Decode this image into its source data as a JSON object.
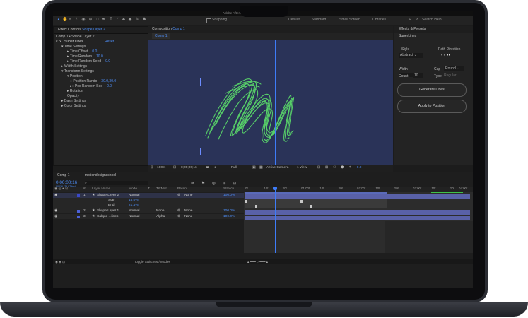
{
  "menubar": {
    "title": "Adobe After Effects 2024 - Untitled Project *"
  },
  "toolbar": {
    "snapping_label": "Snapping",
    "workspaces": [
      "Default",
      "Standard",
      "Small Screen",
      "Libraries"
    ],
    "search_placeholder": "Search Help"
  },
  "effect_controls": {
    "tab_prefix": "Effect Controls",
    "tab_layer": "Shape Layer 2",
    "breadcrumb": "Comp 1 • Shape Layer 2",
    "effect_name": "Super Lines",
    "reset_label": "Reset",
    "properties": [
      {
        "label": "Time Settings",
        "value": ""
      },
      {
        "label": "Time Offset",
        "value": "0.0"
      },
      {
        "label": "Time Random",
        "value": "10.0"
      },
      {
        "label": "Time Random Seed",
        "value": "0.0"
      },
      {
        "label": "Width Settings",
        "value": ""
      },
      {
        "label": "Transform Settings",
        "value": ""
      },
      {
        "label": "Position",
        "value": ""
      },
      {
        "label": "Position Rando",
        "value": "30.0,30.0"
      },
      {
        "label": "Pos Random See",
        "value": "0.0"
      },
      {
        "label": "Rotation",
        "value": ""
      },
      {
        "label": "Opacity",
        "value": ""
      },
      {
        "label": "Dash Settings",
        "value": ""
      },
      {
        "label": "Color Settings",
        "value": ""
      }
    ]
  },
  "composition": {
    "tab_prefix": "Composition",
    "tab_name": "Comp 1",
    "sub_tab": "Comp 1",
    "zoom": "100%",
    "timecode": "0;00;00;16",
    "resolution": "Full",
    "camera": "Active Camera",
    "views": "1 View",
    "exposure": "+0.0"
  },
  "effects_presets": {
    "title": "Effects & Presets",
    "subtitle": "SuperLines",
    "style_label": "Style",
    "style_value": "Abstract",
    "path_direction_label": "Path Direction",
    "width_label": "Width",
    "cap_label": "Cap",
    "cap_value": "Round",
    "count_label": "Count",
    "count_value": "10",
    "type_label": "Type",
    "type_value": "Regular",
    "generate_button": "Generate Lines",
    "apply_button": "Apply to Position"
  },
  "timeline": {
    "tab_comp": "Comp 1",
    "tab_project": "motiondesignschool",
    "timecode": "0;00;00;16",
    "timecode_sub": "00016 (29.97 fps)",
    "columns": [
      "#",
      "Layer Name",
      "Mode",
      "T",
      "TrkMat",
      "Parent",
      "Stretch"
    ],
    "layers": [
      {
        "num": "1",
        "name": "Shape Layer 2",
        "mode": "Normal",
        "trkmat": "",
        "parent": "None",
        "stretch": "100.0%"
      },
      {
        "num": "",
        "name": "Start",
        "mode": "",
        "trkmat": "",
        "parent": "",
        "stretch": "",
        "value": "15.0%"
      },
      {
        "num": "",
        "name": "End",
        "mode": "",
        "trkmat": "",
        "parent": "",
        "stretch": "",
        "value": "21.4%"
      },
      {
        "num": "2",
        "name": "Shape Layer 1",
        "mode": "Normal",
        "trkmat": "None",
        "parent": "None",
        "stretch": "100.0%"
      },
      {
        "num": "3",
        "name": "Calque ...lines",
        "mode": "Normal",
        "trkmat": "Alpha",
        "parent": "None",
        "stretch": "100.0%"
      }
    ],
    "ruler": [
      "0f",
      "10f",
      "20f",
      "01:00f",
      "10f",
      "20f",
      "02:00f",
      "10f",
      "20f",
      "03:00f",
      "10f",
      "20f",
      "04:00f"
    ],
    "toggle_label": "Toggle Switches / Modes"
  },
  "colors": {
    "accent": "#4e8ef7",
    "stroke": "#5ad86a",
    "viewer_bg": "#2a3358",
    "layer_bar": "#5961a8"
  }
}
